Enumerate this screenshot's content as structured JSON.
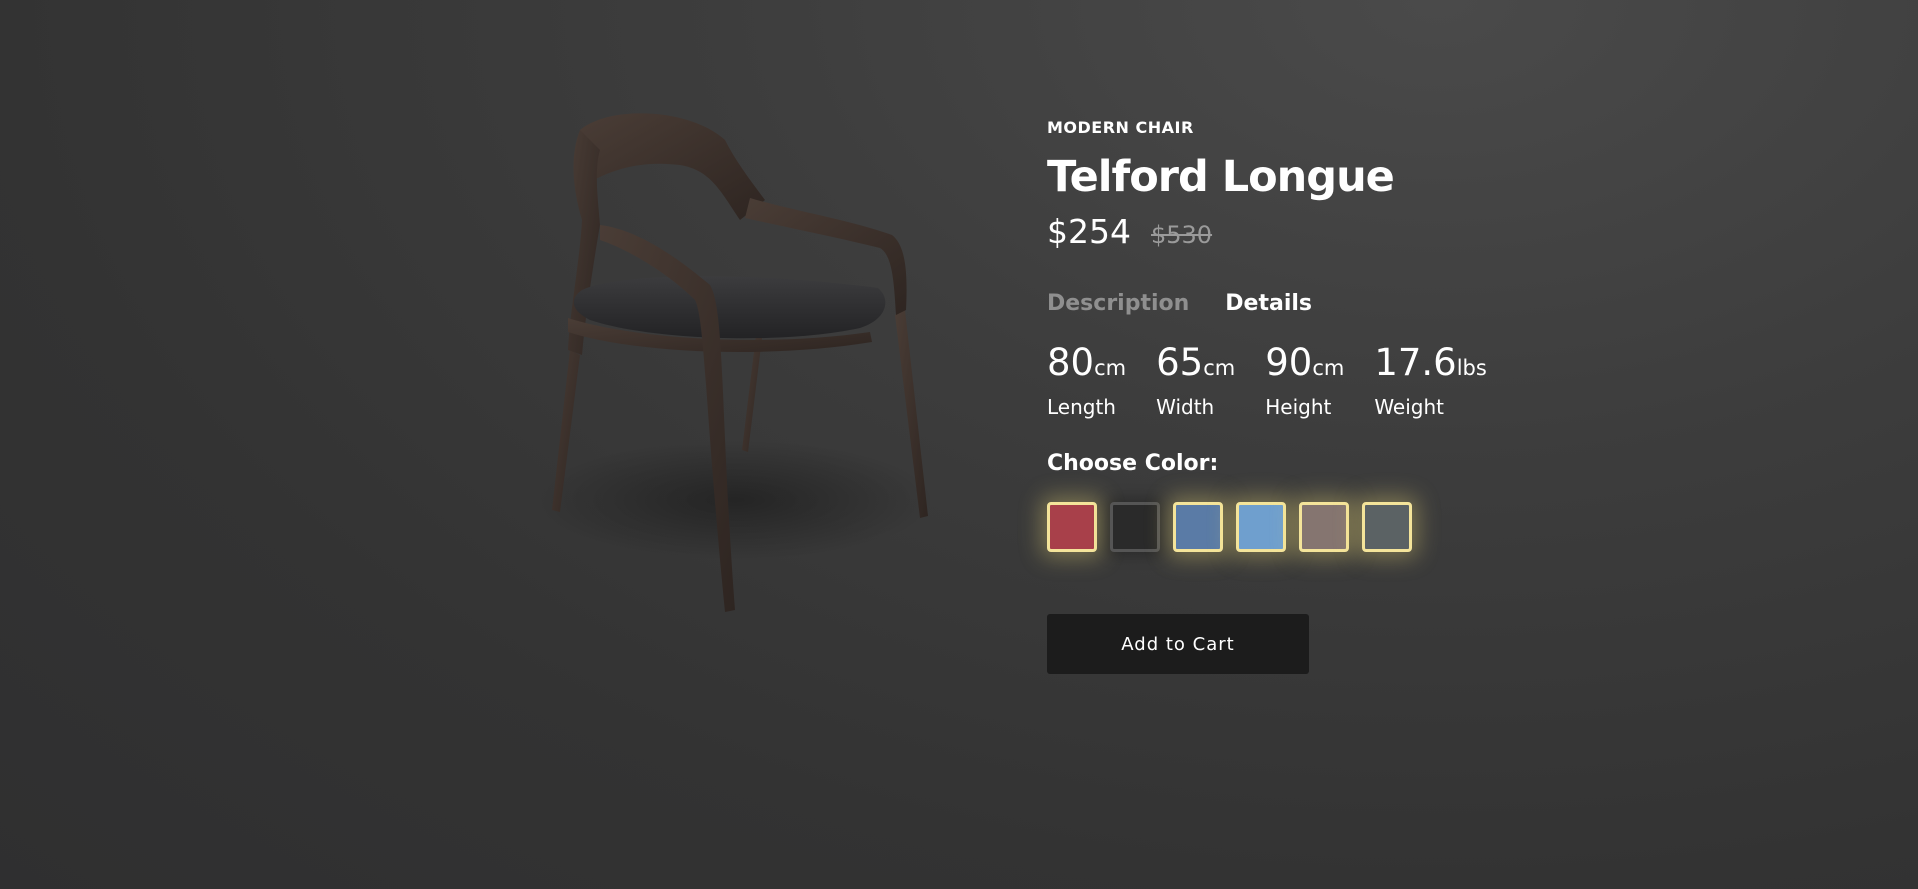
{
  "product": {
    "category": "MODERN CHAIR",
    "name": "Telford Longue",
    "price": "$254",
    "original_price": "$530"
  },
  "tabs": [
    {
      "label": "Description",
      "active": false
    },
    {
      "label": "Details",
      "active": true
    }
  ],
  "specs": [
    {
      "value": "80",
      "unit": "cm",
      "label": "Length"
    },
    {
      "value": "65",
      "unit": "cm",
      "label": "Width"
    },
    {
      "value": "90",
      "unit": "cm",
      "label": "Height"
    },
    {
      "value": "17.6",
      "unit": "lbs",
      "label": "Weight"
    }
  ],
  "color_picker": {
    "label": "Choose Color:",
    "swatches": [
      {
        "name": "red",
        "color": "#a8404a",
        "selected": false
      },
      {
        "name": "black",
        "color": "#2a2a2a",
        "selected": true
      },
      {
        "name": "denim",
        "color": "#5a7ba6",
        "selected": false
      },
      {
        "name": "light-blue",
        "color": "#6f9fce",
        "selected": false
      },
      {
        "name": "taupe",
        "color": "#857570",
        "selected": false
      },
      {
        "name": "slate",
        "color": "#5b6264",
        "selected": false
      }
    ]
  },
  "cart": {
    "button_label": "Add to Cart"
  },
  "colors": {
    "swatch_border": "#f4e49a",
    "button_bg": "#1c1c1c",
    "muted_text": "#8f8f8f"
  }
}
